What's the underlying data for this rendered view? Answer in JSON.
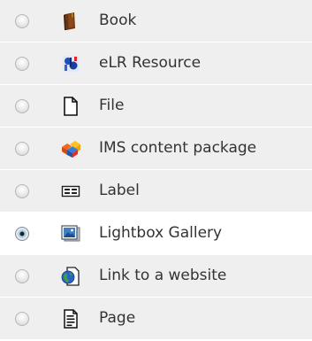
{
  "items": [
    {
      "label": "Book",
      "icon": "book-icon",
      "selected": false
    },
    {
      "label": "eLR Resource",
      "icon": "elr-resource-icon",
      "selected": false
    },
    {
      "label": "File",
      "icon": "file-icon",
      "selected": false
    },
    {
      "label": "IMS content package",
      "icon": "ims-package-icon",
      "selected": false
    },
    {
      "label": "Label",
      "icon": "label-icon",
      "selected": false
    },
    {
      "label": "Lightbox Gallery",
      "icon": "gallery-icon",
      "selected": true
    },
    {
      "label": "Link to a website",
      "icon": "globe-icon",
      "selected": false
    },
    {
      "label": "Page",
      "icon": "page-icon",
      "selected": false
    }
  ],
  "colors": {
    "row_background": "#efefef",
    "selected_row_background": "#ffffff",
    "text": "#333333"
  }
}
